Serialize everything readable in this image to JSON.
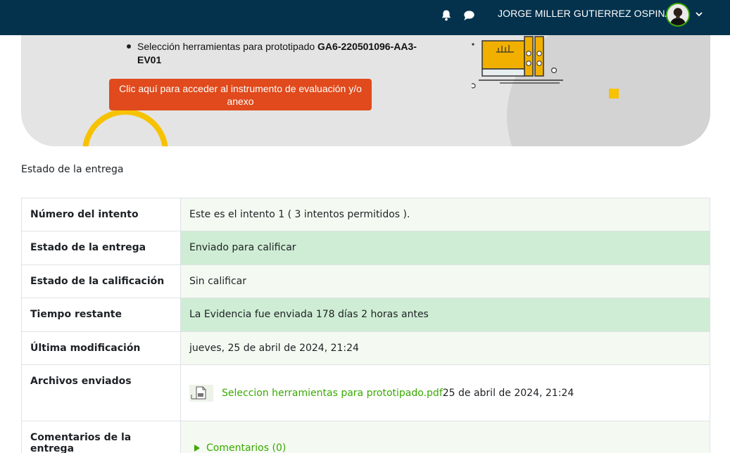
{
  "header": {
    "user_name": "JORGE MILLER GUTIERREZ OSPINA",
    "icons": [
      "bell-icon",
      "chat-icon",
      "avatar",
      "chevron-down-icon"
    ],
    "bar_color": "#04324d"
  },
  "banner": {
    "bullet_text": "Selección herramientas para prototipado ",
    "bullet_code": "GA6-220501096-AA3-EV01",
    "button_label": "Clic aquí para acceder al instrumento de evaluación y/o anexo",
    "button_color": "#e04a1c",
    "accent_color": "#f7c200"
  },
  "submission": {
    "section_title": "Estado de la entrega",
    "rows": [
      {
        "label": "Número del intento",
        "value": "Este es el intento 1 ( 3 intentos permitidos )."
      },
      {
        "label": "Estado de la entrega",
        "value": "Enviado para calificar"
      },
      {
        "label": "Estado de la calificación",
        "value": "Sin calificar"
      },
      {
        "label": "Tiempo restante",
        "value": "La Evidencia fue enviada 178 días 2 horas antes"
      },
      {
        "label": "Última modificación",
        "value": "jueves, 25 de abril de 2024, 21:24"
      },
      {
        "label": "Archivos enviados",
        "file_name": "Seleccion herramientas para prototipado.pdf",
        "file_date": "25 de abril de 2024, 21:24"
      },
      {
        "label": "Comentarios de la entrega",
        "value": "Comentarios (0)"
      }
    ],
    "link_color": "#39a900",
    "highlight_color": "#cfedd4"
  }
}
